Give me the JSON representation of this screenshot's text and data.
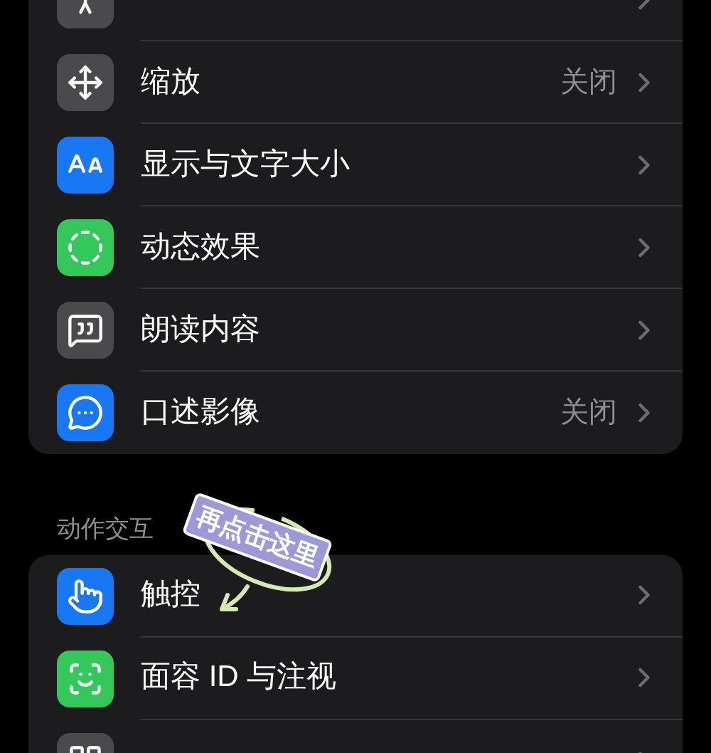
{
  "sections": [
    {
      "rows": [
        {
          "color": "#4a4a4c"
        },
        {
          "label": "缩放",
          "value": "关闭",
          "color": "#4a4a4c"
        },
        {
          "label": "显示与文字大小",
          "value": null,
          "color": "#1877f2"
        },
        {
          "label": "动态效果",
          "value": null,
          "color": "#34c759"
        },
        {
          "label": "朗读内容",
          "value": null,
          "color": "#4a4a4c"
        },
        {
          "label": "口述影像",
          "value": "关闭",
          "color": "#1877f2"
        }
      ]
    },
    {
      "header": "动作交互",
      "rows": [
        {
          "label": "触控",
          "value": null,
          "color": "#1877f2"
        },
        {
          "label": "面容 ID 与注视",
          "value": null,
          "color": "#34c759"
        },
        {
          "color": "#4a4a4c"
        }
      ]
    }
  ],
  "annotation": {
    "text": "再点击这里"
  }
}
